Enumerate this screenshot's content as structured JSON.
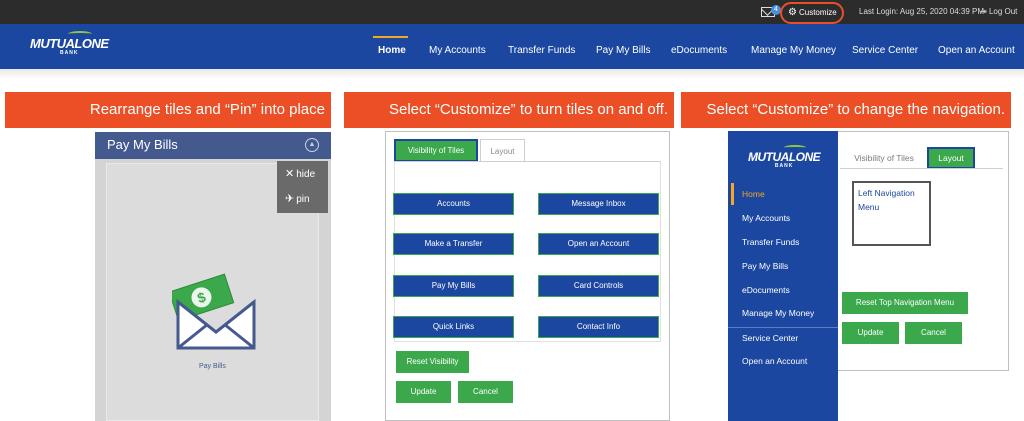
{
  "utility_bar": {
    "mail_badge": "4",
    "customize_label": "Customize",
    "last_login": "Last Login: Aug 25, 2020 04:39 PM",
    "logout_label": "Log Out"
  },
  "brand": {
    "logo_text": "MUTUALONE",
    "logo_sub": "BANK"
  },
  "main_nav": {
    "items": [
      "Home",
      "My Accounts",
      "Transfer Funds",
      "Pay My Bills",
      "eDocuments",
      "Manage My Money",
      "Service Center",
      "Open an Account"
    ],
    "active": "Home"
  },
  "banners": [
    "Rearrange tiles and “Pin” into place",
    "Select “Customize” to turn tiles on and off.",
    "Select “Customize” to change the navigation."
  ],
  "tile_panel": {
    "title": "Pay My Bills",
    "menu_hide": "hide",
    "menu_pin": "pin",
    "caption": "Pay Bills"
  },
  "visibility_panel": {
    "tab_visibility": "Visibility of Tiles",
    "tab_layout": "Layout",
    "tiles": [
      "Accounts",
      "Message Inbox",
      "Make a Transfer",
      "Open an Account",
      "Pay My Bills",
      "Card Controls",
      "Quick Links",
      "Contact Info"
    ],
    "reset_label": "Reset Visibility",
    "update_label": "Update",
    "cancel_label": "Cancel"
  },
  "navigation_panel": {
    "side_items": [
      "Home",
      "My Accounts",
      "Transfer Funds",
      "Pay My Bills",
      "eDocuments",
      "Manage My Money",
      "Service Center",
      "Open an Account"
    ],
    "tab_visibility": "Visibility of Tiles",
    "tab_layout": "Layout",
    "box_line1": "Left Navigation",
    "box_line2": "Menu",
    "reset_label": "Reset Top Navigation Menu",
    "update_label": "Update",
    "cancel_label": "Cancel"
  },
  "colors": {
    "brand_blue": "#1b47a0",
    "accent_orange": "#ec4f25",
    "action_green": "#3aa84b",
    "active_gold": "#f5a623",
    "tile_header": "#44598d"
  }
}
